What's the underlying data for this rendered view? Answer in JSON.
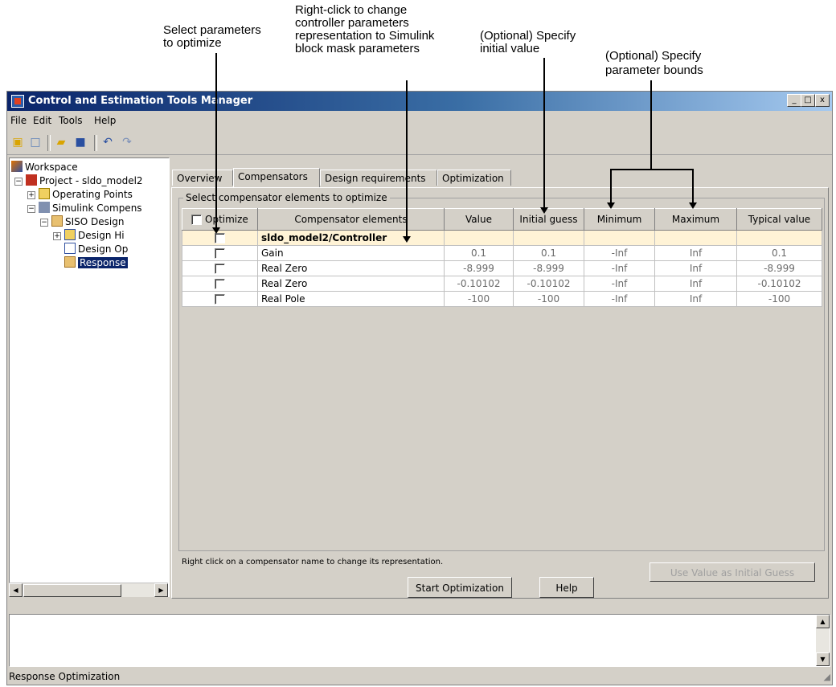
{
  "annotations": {
    "select_params": "Select parameters\nto optimize",
    "right_click": "Right-click to change\ncontroller parameters\nrepresentation to Simulink\nblock mask parameters",
    "initial_value": "(Optional) Specify\ninitial value",
    "bounds_1": "(Optional) Specify",
    "bounds_2": "parameter bounds"
  },
  "window": {
    "title": "Control and Estimation Tools Manager",
    "controls": [
      "_",
      "□",
      "x"
    ]
  },
  "menu": [
    "File",
    "Edit",
    "Tools",
    "Help"
  ],
  "toolbar": [
    "new-project-icon",
    "new-task-icon",
    "open-icon",
    "save-icon",
    "undo-icon",
    "redo-icon"
  ],
  "tree": {
    "workspace": "Workspace",
    "project": "Project - sldo_model2",
    "operating_points": "Operating Points",
    "simulink_compens": "Simulink Compens",
    "siso_design": "SISO Design",
    "design_hi": "Design Hi",
    "design_op": "Design Op",
    "response": "Response"
  },
  "tabs": [
    "Overview",
    "Compensators",
    "Design requirements",
    "Optimization"
  ],
  "active_tab": "Compensators",
  "group_label": "Select compensator elements to optimize",
  "table": {
    "headers": [
      "Optimize",
      "Compensator elements",
      "Value",
      "Initial guess",
      "Minimum",
      "Maximum",
      "Typical value"
    ],
    "group": "sldo_model2/Controller",
    "rows": [
      {
        "name": "Gain",
        "value": "0.1",
        "initial": "0.1",
        "min": "-Inf",
        "max": "Inf",
        "typical": "0.1"
      },
      {
        "name": "Real Zero",
        "value": "-8.999",
        "initial": "-8.999",
        "min": "-Inf",
        "max": "Inf",
        "typical": "-8.999"
      },
      {
        "name": "Real Zero",
        "value": "-0.10102",
        "initial": "-0.10102",
        "min": "-Inf",
        "max": "Inf",
        "typical": "-0.10102"
      },
      {
        "name": "Real Pole",
        "value": "-100",
        "initial": "-100",
        "min": "-Inf",
        "max": "Inf",
        "typical": "-100"
      }
    ]
  },
  "hint": "Right click on a compensator name to change its representation.",
  "use_value_button": "Use Value as Initial Guess",
  "start_button": "Start Optimization",
  "help_button": "Help",
  "status": "Response Optimization"
}
